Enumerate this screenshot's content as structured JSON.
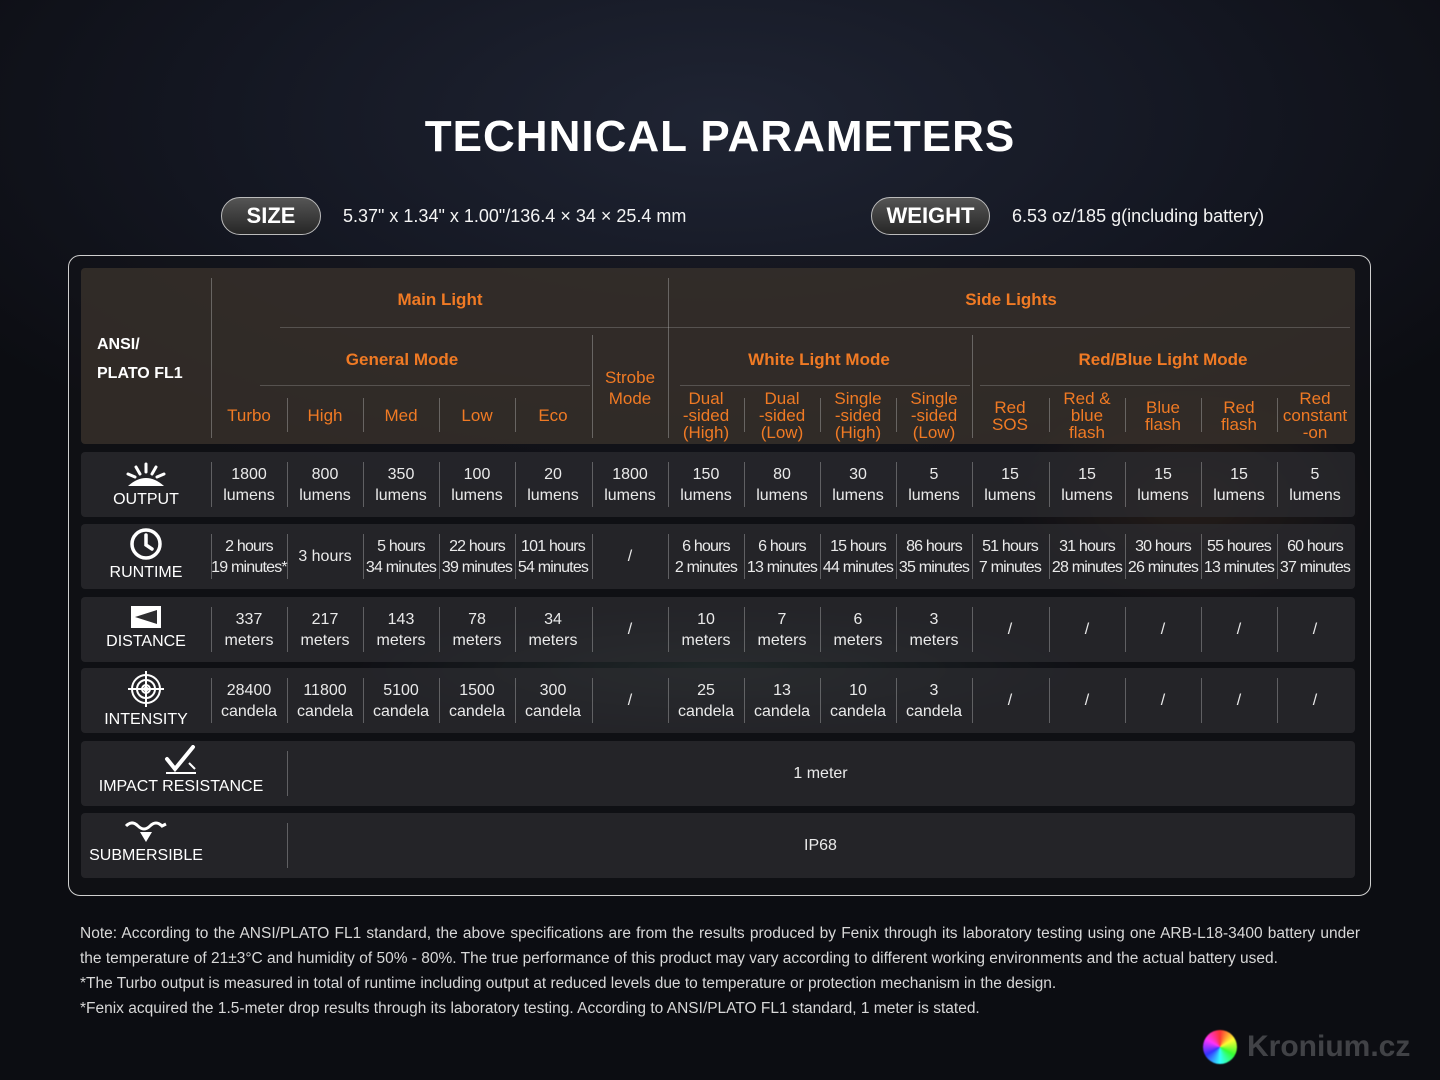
{
  "title": "TECHNICAL PARAMETERS",
  "size": {
    "label": "SIZE",
    "value": "5.37\" x 1.34\" x 1.00\"/136.4 × 34 × 25.4 mm"
  },
  "weight": {
    "label": "WEIGHT",
    "value": "6.53 oz/185 g(including battery)"
  },
  "table": {
    "corner": [
      "ANSI/",
      "PLATO FL1"
    ],
    "main_light": "Main Light",
    "side_lights": "Side Lights",
    "general_mode": "General Mode",
    "white_mode": "White Light Mode",
    "redblue_mode": "Red/Blue Light Mode",
    "strobe": [
      "Strobe",
      "Mode"
    ],
    "columns": [
      [
        "Turbo"
      ],
      [
        "High"
      ],
      [
        "Med"
      ],
      [
        "Low"
      ],
      [
        "Eco"
      ],
      [],
      [
        "Dual",
        "-sided",
        "(High)"
      ],
      [
        "Dual",
        "-sided",
        "(Low)"
      ],
      [
        "Single",
        "-sided",
        "(High)"
      ],
      [
        "Single",
        "-sided",
        "(Low)"
      ],
      [
        "Red",
        "SOS"
      ],
      [
        "Red &",
        "blue",
        "flash"
      ],
      [
        "Blue",
        "flash"
      ],
      [
        "Red",
        "flash"
      ],
      [
        "Red",
        "constant",
        "-on"
      ]
    ],
    "rows": [
      {
        "label": "OUTPUT",
        "icon": "sunburst-icon",
        "cells": [
          [
            "1800",
            "lumens"
          ],
          [
            "800",
            "lumens"
          ],
          [
            "350",
            "lumens"
          ],
          [
            "100",
            "lumens"
          ],
          [
            "20",
            "lumens"
          ],
          [
            "1800",
            "lumens"
          ],
          [
            "150",
            "lumens"
          ],
          [
            "80",
            "lumens"
          ],
          [
            "30",
            "lumens"
          ],
          [
            "5",
            "lumens"
          ],
          [
            "15",
            "lumens"
          ],
          [
            "15",
            "lumens"
          ],
          [
            "15",
            "lumens"
          ],
          [
            "15",
            "lumens"
          ],
          [
            "5",
            "lumens"
          ]
        ]
      },
      {
        "label": "RUNTIME",
        "icon": "clock-icon",
        "cells": [
          [
            "2 hours",
            "19 minutes*"
          ],
          [
            "3 hours"
          ],
          [
            "5 hours",
            "34 minutes"
          ],
          [
            "22 hours",
            "39 minutes"
          ],
          [
            "101 hours",
            "54 minutes"
          ],
          [
            "/"
          ],
          [
            "6 hours",
            "2 minutes"
          ],
          [
            "6 hours",
            "13 minutes"
          ],
          [
            "15 hours",
            "44 minutes"
          ],
          [
            "86 hours",
            "35 minutes"
          ],
          [
            "51 hours",
            "7 minutes"
          ],
          [
            "31 hours",
            "28 minutes"
          ],
          [
            "30 hours",
            "26 minutes"
          ],
          [
            "55 houres",
            "13 minutes"
          ],
          [
            "60 hours",
            "37 minutes"
          ]
        ]
      },
      {
        "label": "DISTANCE",
        "icon": "distance-icon",
        "cells": [
          [
            "337",
            "meters"
          ],
          [
            "217",
            "meters"
          ],
          [
            "143",
            "meters"
          ],
          [
            "78",
            "meters"
          ],
          [
            "34",
            "meters"
          ],
          [
            "/"
          ],
          [
            "10",
            "meters"
          ],
          [
            "7",
            "meters"
          ],
          [
            "6",
            "meters"
          ],
          [
            "3",
            "meters"
          ],
          [
            "/"
          ],
          [
            "/"
          ],
          [
            "/"
          ],
          [
            "/"
          ],
          [
            "/"
          ]
        ]
      },
      {
        "label": "INTENSITY",
        "icon": "crosshair-icon",
        "cells": [
          [
            "28400",
            "candela"
          ],
          [
            "11800",
            "candela"
          ],
          [
            "5100",
            "candela"
          ],
          [
            "1500",
            "candela"
          ],
          [
            "300",
            "candela"
          ],
          [
            "/"
          ],
          [
            "25",
            "candela"
          ],
          [
            "13",
            "candela"
          ],
          [
            "10",
            "candela"
          ],
          [
            "3",
            "candela"
          ],
          [
            "/"
          ],
          [
            "/"
          ],
          [
            "/"
          ],
          [
            "/"
          ],
          [
            "/"
          ]
        ]
      }
    ],
    "impact": {
      "label": "IMPACT RESISTANCE",
      "icon": "impact-icon",
      "value": "1 meter"
    },
    "submersible": {
      "label": "SUBMERSIBLE",
      "icon": "water-icon",
      "value": "IP68"
    }
  },
  "notes": [
    "Note: According to the ANSI/PLATO FL1 standard, the above specifications are from the results produced by Fenix through its laboratory testing using one ARB-L18-3400 battery under the temperature of 21±3°C and humidity of 50% - 80%. The true performance of this product may vary according to different working environments and the actual battery used.",
    "*The Turbo output is measured in total of runtime including output at reduced levels due to temperature or protection mechanism in the design.",
    "*Fenix acquired the 1.5-meter drop results through its laboratory testing. According to ANSI/PLATO FL1 standard, 1 meter is stated."
  ],
  "watermark": "Kronium.cz"
}
